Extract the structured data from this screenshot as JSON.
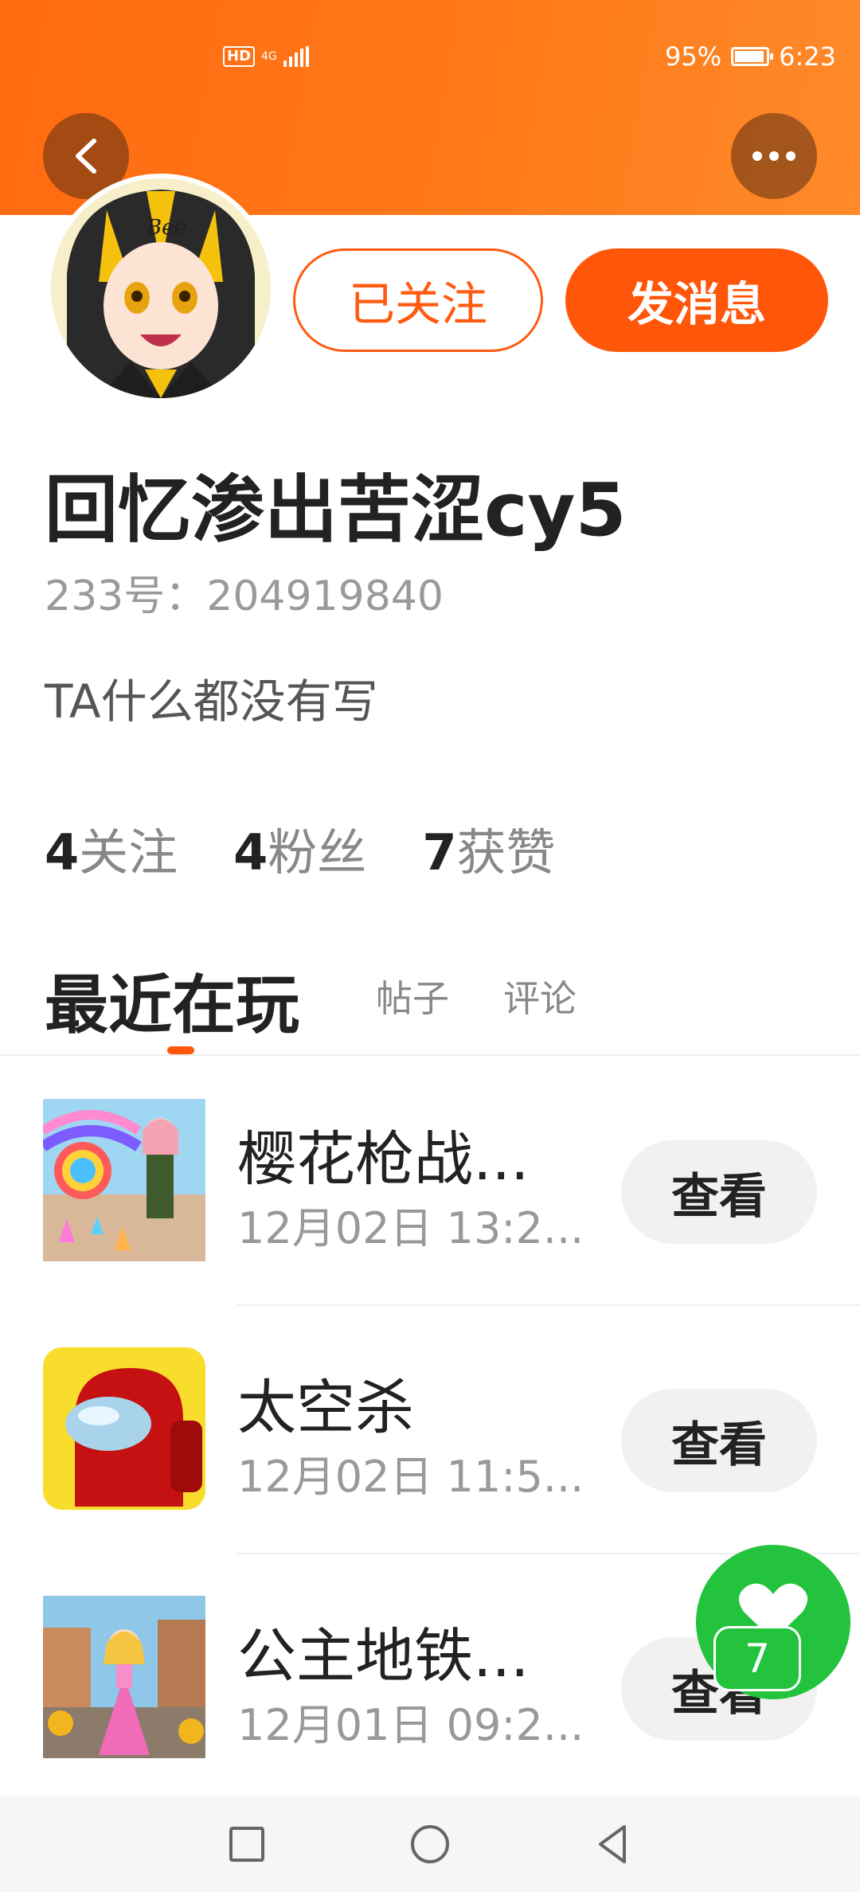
{
  "status_bar": {
    "network_hd": "HD",
    "network_type": "4G",
    "battery_percent": "95%",
    "time": "6:23"
  },
  "profile": {
    "followed_label": "已关注",
    "message_label": "发消息",
    "username": "回忆渗出苦涩cy5",
    "id_text": "233号：204919840",
    "bio": "TA什么都没有写"
  },
  "stats": [
    {
      "count": "4",
      "label": "关注"
    },
    {
      "count": "4",
      "label": "粉丝"
    },
    {
      "count": "7",
      "label": "获赞"
    }
  ],
  "tabs": {
    "active": "最近在玩",
    "posts": "帖子",
    "comments": "评论"
  },
  "games": [
    {
      "title": "樱花枪战...",
      "time": "12月02日 13:2...",
      "button": "查看"
    },
    {
      "title": "太空杀",
      "time": "12月02日 11:5...",
      "button": "查看"
    },
    {
      "title": "公主地铁...",
      "time": "12月01日 09:2...",
      "button": "查看"
    }
  ],
  "like_float": {
    "count": "7"
  },
  "colors": {
    "accent": "#ff560a",
    "like_green": "#23c33d",
    "header_orange": "#ff7a1a"
  },
  "icons": [
    "back-arrow-icon",
    "more-dots-icon",
    "heart-icon",
    "nav-recent-square-icon",
    "nav-home-circle-icon",
    "nav-back-triangle-icon"
  ]
}
